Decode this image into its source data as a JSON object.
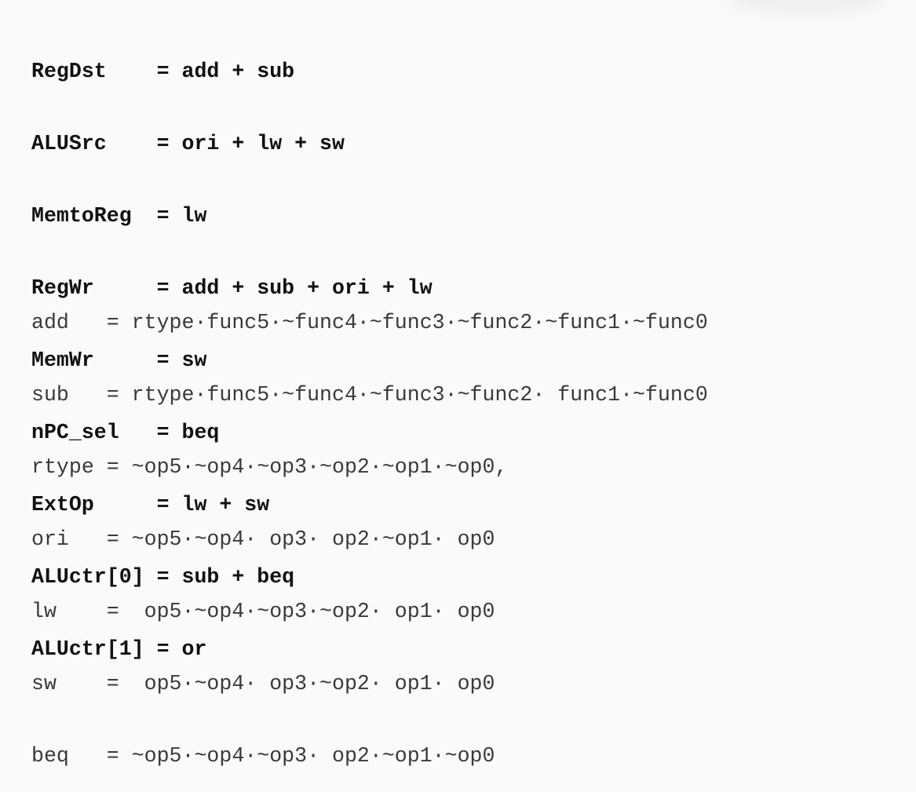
{
  "control_signals": [
    "RegDst    = add + sub",
    "ALUSrc    = ori + lw + sw",
    "MemtoReg  = lw",
    "RegWr     = add + sub + ori + lw",
    "MemWr     = sw",
    "nPC_sel   = beq",
    "ExtOp     = lw + sw",
    "ALUctr[0] = sub + beq",
    "ALUctr[1] = or"
  ],
  "instruction_decodes": [
    "add   = rtype·func5·~func4·~func3·~func2·~func1·~func0",
    "sub   = rtype·func5·~func4·~func3·~func2· func1·~func0",
    "rtype = ~op5·~op4·~op3·~op2·~op1·~op0,",
    "ori   = ~op5·~op4· op3· op2·~op1· op0",
    "lw    =  op5·~op4·~op3·~op2· op1· op0",
    "sw    =  op5·~op4· op3·~op2· op1· op0",
    "beq   = ~op5·~op4·~op3· op2·~op1·~op0"
  ]
}
